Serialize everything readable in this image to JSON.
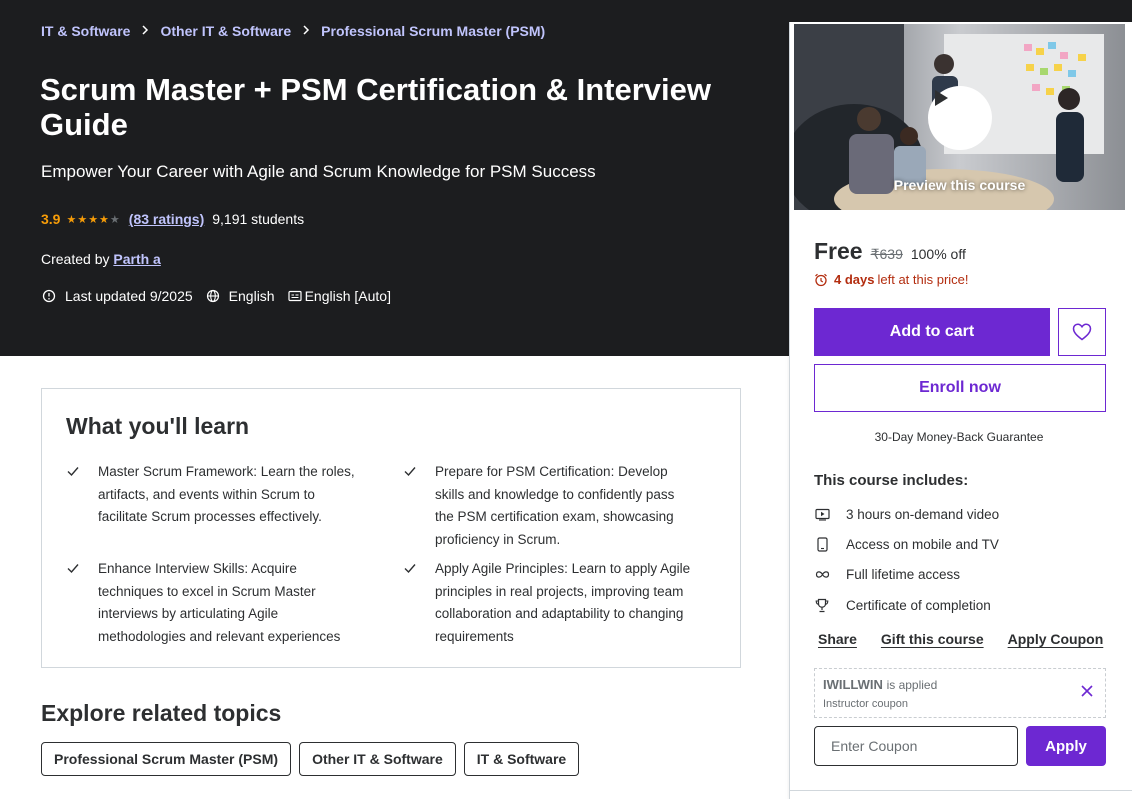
{
  "breadcrumb": [
    "IT & Software",
    "Other IT & Software",
    "Professional Scrum Master (PSM)"
  ],
  "course": {
    "title": "Scrum Master + PSM Certification & Interview Guide",
    "subtitle": "Empower Your Career with Agile and Scrum Knowledge for PSM Success",
    "rating": "3.9",
    "stars": "★★★★★",
    "rating_fraction": 0.78,
    "ratings_link": "(83 ratings)",
    "students": "9,191 students",
    "created_by_label": "Created by",
    "instructor": "Parth a",
    "last_updated": "Last updated 9/2025",
    "language": "English",
    "captions": "English [Auto]"
  },
  "learn": {
    "title": "What you'll learn",
    "items": [
      "Master Scrum Framework: Learn the roles, artifacts, and events within Scrum to facilitate Scrum processes effectively.",
      "Prepare for PSM Certification: Develop skills and knowledge to confidently pass the PSM certification exam, showcasing proficiency in Scrum.",
      "Enhance Interview Skills: Acquire techniques to excel in Scrum Master interviews by articulating Agile methodologies and relevant experiences",
      "Apply Agile Principles: Learn to apply Agile principles in real projects, improving team collaboration and adaptability to changing requirements"
    ]
  },
  "explore": {
    "title": "Explore related topics",
    "topics": [
      "Professional Scrum Master (PSM)",
      "Other IT & Software",
      "IT & Software"
    ]
  },
  "sidebar": {
    "preview_label": "Preview this course",
    "price": "Free",
    "original_price": "₹639",
    "discount": "100% off",
    "timer_bold": "4 days",
    "timer_rest": "left at this price!",
    "add_to_cart": "Add to cart",
    "enroll": "Enroll now",
    "guarantee": "30-Day Money-Back Guarantee",
    "includes_title": "This course includes:",
    "includes": [
      "3 hours on-demand video",
      "Access on mobile and TV",
      "Full lifetime access",
      "Certificate of completion"
    ],
    "share": "Share",
    "gift": "Gift this course",
    "apply_coupon": "Apply Coupon",
    "coupon_code": "IWILLWIN",
    "coupon_applied": "is applied",
    "coupon_sub": "Instructor coupon",
    "coupon_placeholder": "Enter Coupon",
    "apply": "Apply"
  },
  "colors": {
    "hero_bg": "#1c1d1f",
    "accent": "#6d28d2",
    "link": "#c0c4fc",
    "star": "#f69c08",
    "timer": "#b32d0f"
  },
  "icons": [
    "chevron-right-icon",
    "star-icon",
    "alert-badge-icon",
    "globe-icon",
    "captions-icon",
    "check-icon",
    "play-icon",
    "heart-icon",
    "alarm-icon",
    "video-icon",
    "mobile-icon",
    "infinity-icon",
    "trophy-icon",
    "close-icon"
  ]
}
